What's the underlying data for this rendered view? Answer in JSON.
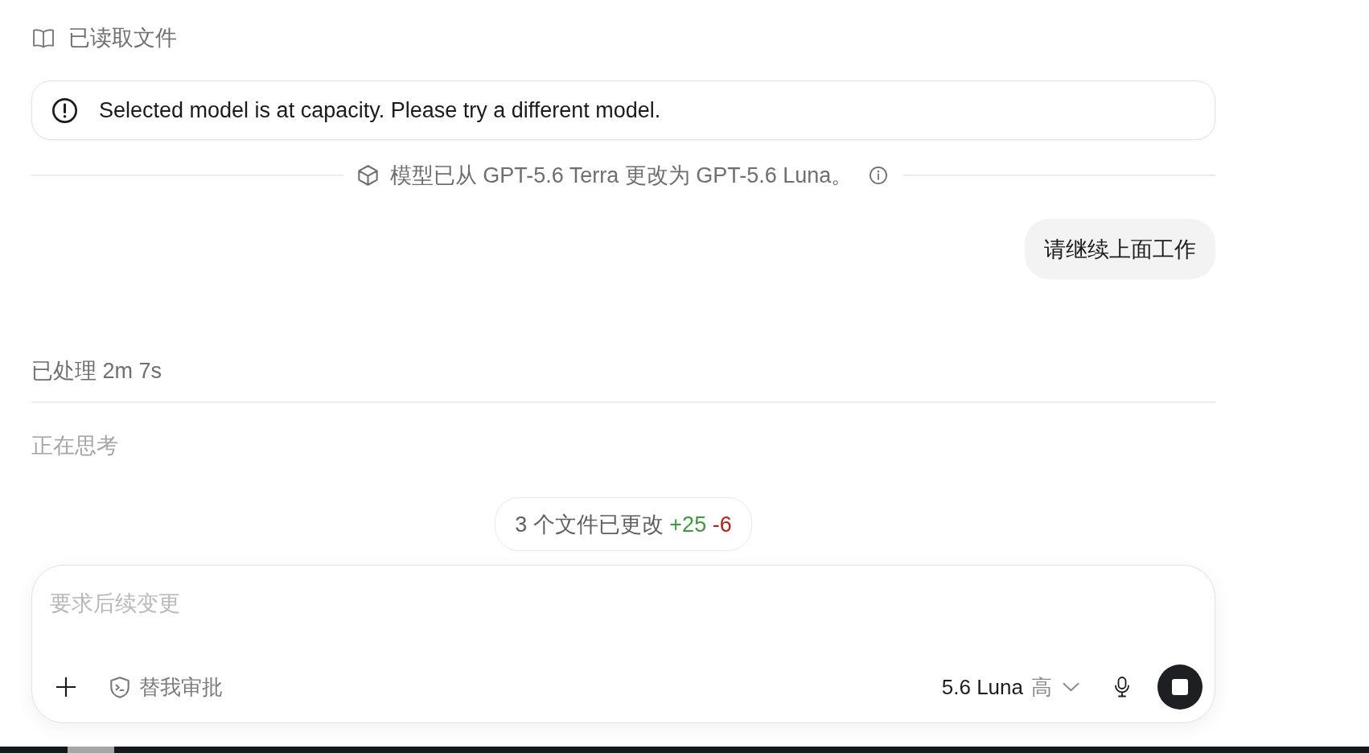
{
  "activity": {
    "label": "已读取文件"
  },
  "alert": {
    "message": "Selected model is at capacity. Please try a different model."
  },
  "model_change": {
    "text": "模型已从 GPT-5.6 Terra 更改为 GPT-5.6 Luna。"
  },
  "user_message": {
    "text": "请继续上面工作"
  },
  "processed": {
    "text": "已处理 2m 7s"
  },
  "status": {
    "text": "正在思考"
  },
  "changes": {
    "summary": "3 个文件已更改",
    "additions": "+25",
    "deletions": "-6"
  },
  "composer": {
    "placeholder": "要求后续变更",
    "approval_mode": "替我审批",
    "model": "5.6 Luna",
    "effort": "高",
    "running": true
  }
}
